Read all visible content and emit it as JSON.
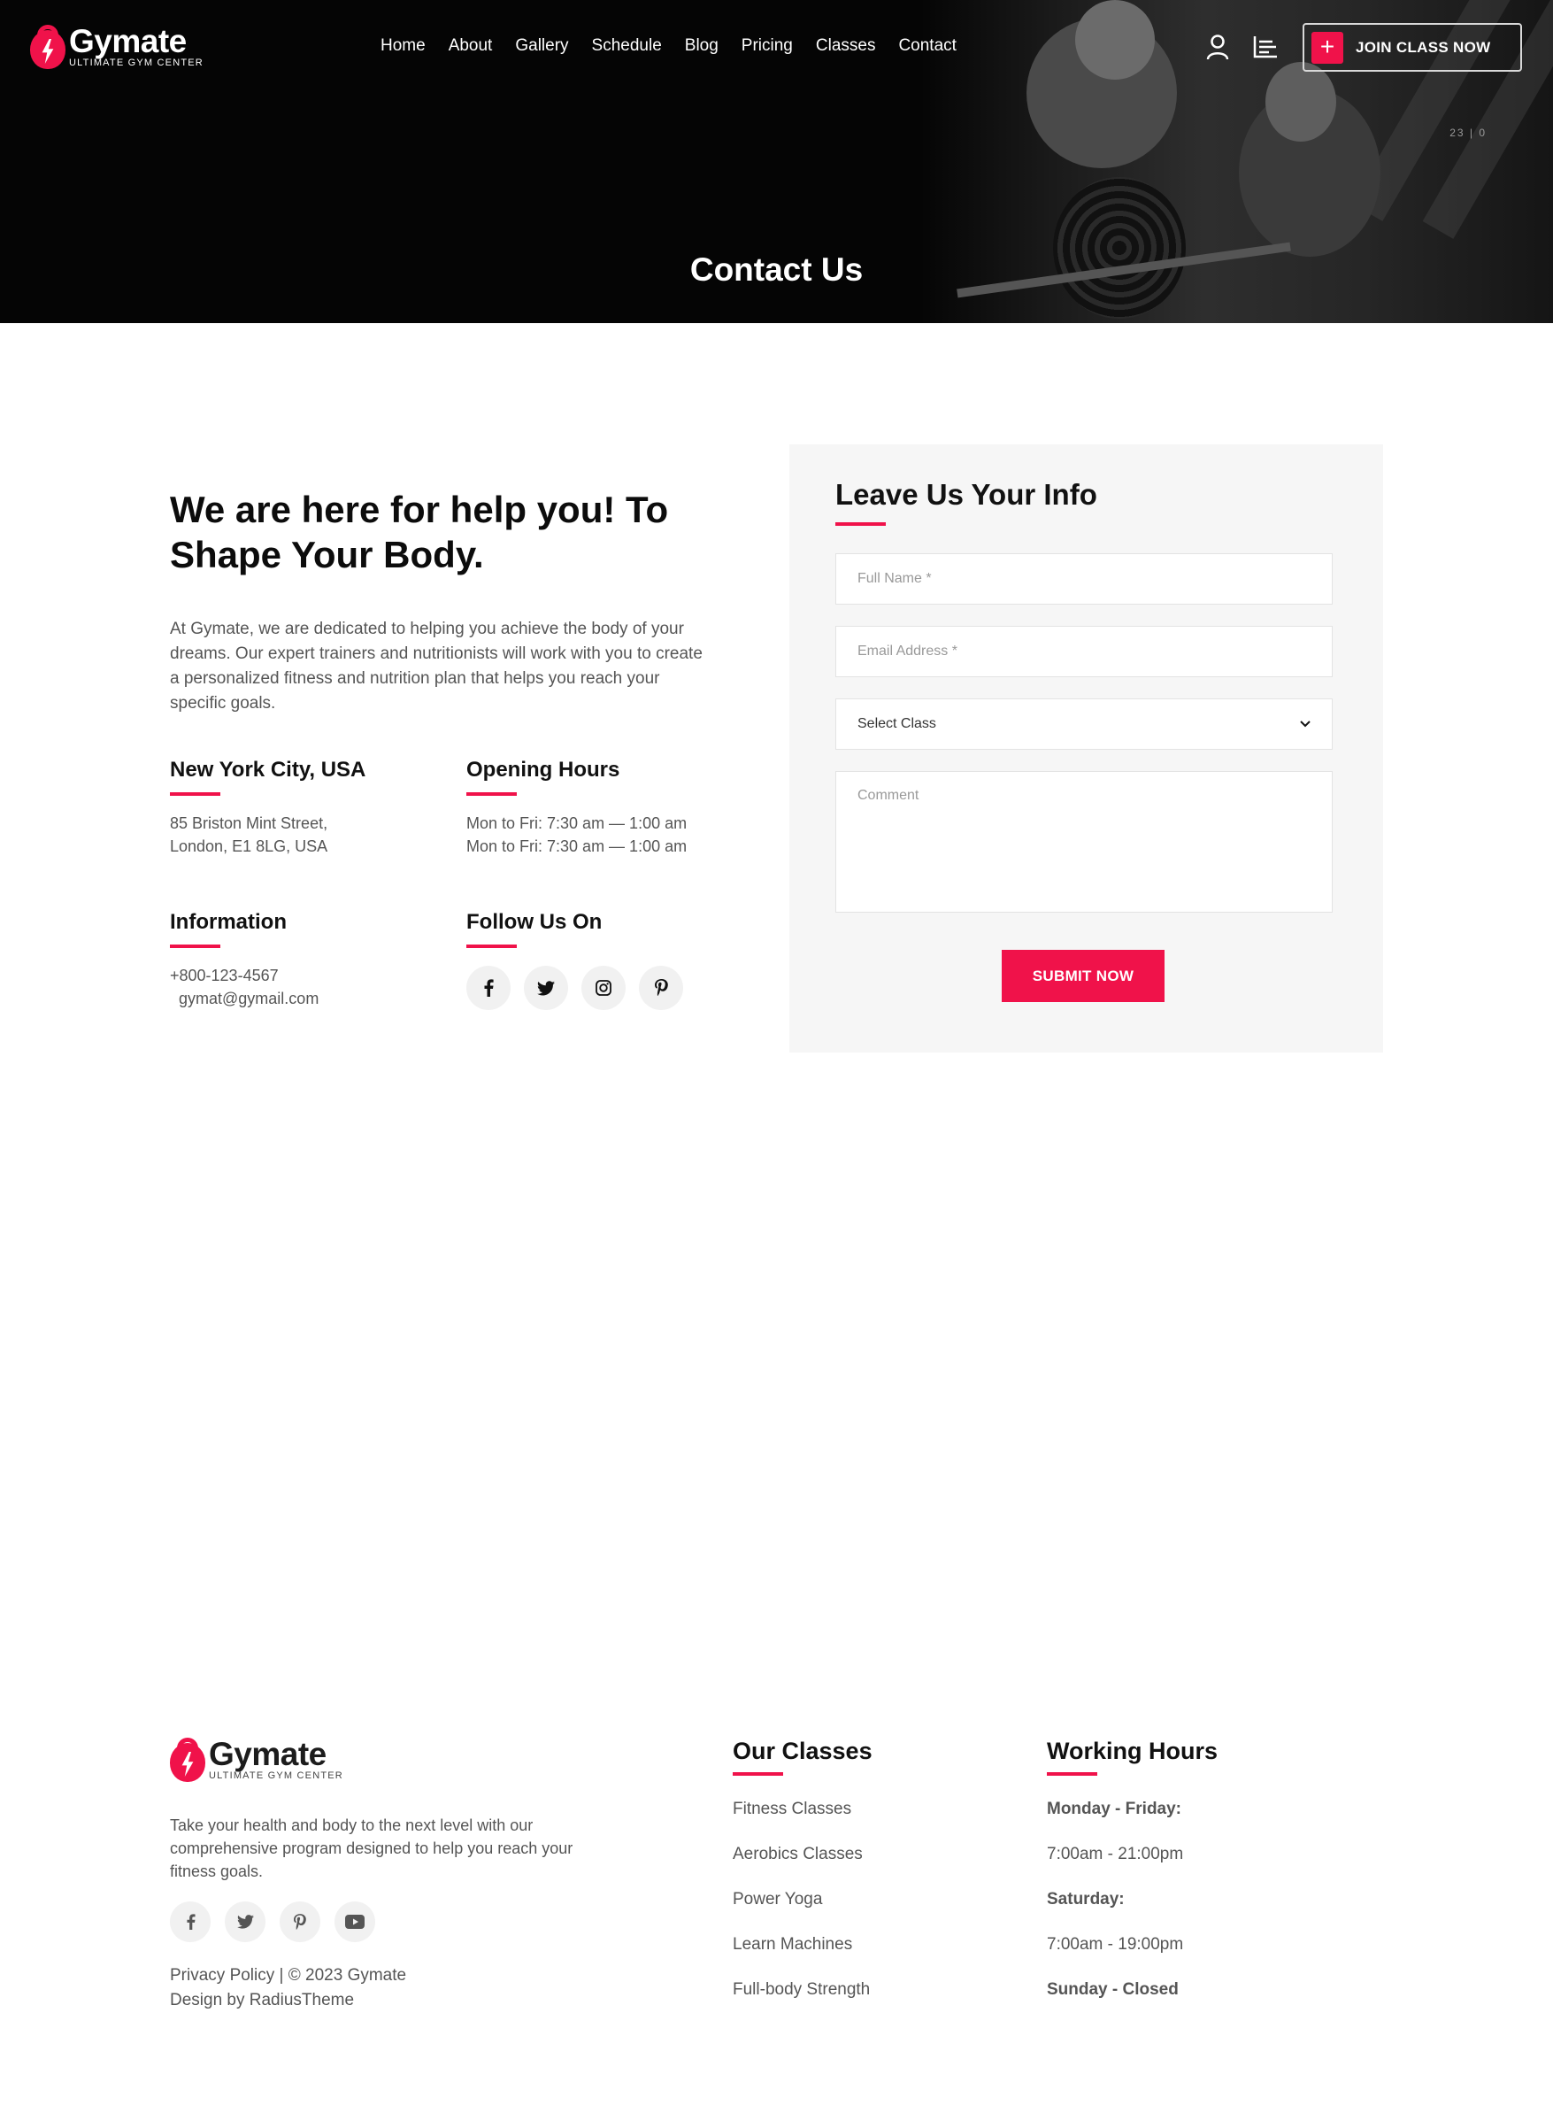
{
  "brand": {
    "name": "Gymate",
    "tagline": "ULTIMATE GYM CENTER",
    "accent": "#f0124a"
  },
  "nav": [
    "Home",
    "About",
    "Gallery",
    "Schedule",
    "Blog",
    "Pricing",
    "Classes",
    "Contact"
  ],
  "header": {
    "join_label": "JOIN CLASS NOW",
    "hero_counter": "23 | 0",
    "user_icon": "user-icon",
    "menu_icon": "menu-icon"
  },
  "hero": {
    "title": "Contact Us"
  },
  "contact": {
    "heading": "We are here for help you! To Shape Your Body.",
    "text": "At Gymate, we are dedicated to helping you achieve the body of your dreams. Our expert trainers and nutritionists will work with you to create a personalized fitness and nutrition plan that helps you reach your specific goals.",
    "location": {
      "title": "New York City, USA",
      "lines": [
        "85 Briston Mint Street,",
        "London, E1 8LG, USA"
      ]
    },
    "hours": {
      "title": "Opening Hours",
      "lines": [
        "Mon to Fri: 7:30 am — 1:00 am",
        "Mon to Fri: 7:30 am — 1:00 am"
      ]
    },
    "information": {
      "title": "Information",
      "lines": [
        "+800-123-4567",
        "gymat@gymail.com"
      ]
    },
    "follow": {
      "title": "Follow Us On",
      "icons": [
        "facebook-icon",
        "twitter-icon",
        "instagram-icon",
        "pinterest-icon"
      ]
    }
  },
  "form": {
    "title": "Leave Us Your Info",
    "full_name_placeholder": "Full Name *",
    "email_placeholder": "Email Address *",
    "select_value": "Select Class",
    "comment_placeholder": "Comment",
    "submit_label": "SUBMIT NOW"
  },
  "footer": {
    "description": "Take your health and body to the next level with our comprehensive program designed to help you reach your fitness goals.",
    "social_icons": [
      "facebook-icon",
      "twitter-icon",
      "pinterest-icon",
      "youtube-icon"
    ],
    "legal": "Privacy Policy | © 2023 Gymate",
    "credit": "Design by RadiusTheme",
    "classes_title": "Our Classes",
    "classes": [
      "Fitness Classes",
      "Aerobics Classes",
      "Power Yoga",
      "Learn Machines",
      "Full-body Strength"
    ],
    "hours_title": "Working Hours",
    "hours": [
      "Monday - Friday:",
      "7:00am - 21:00pm",
      "Saturday:",
      "7:00am - 19:00pm",
      "Sunday - Closed"
    ]
  }
}
